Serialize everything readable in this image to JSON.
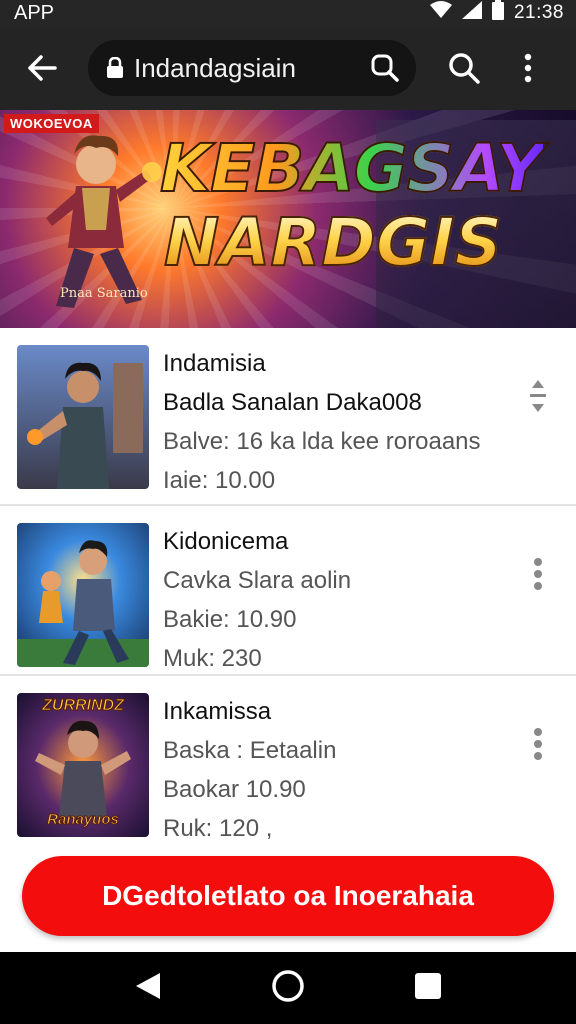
{
  "status_bar": {
    "app_label": "APP",
    "time": "21:38"
  },
  "browser": {
    "url": "Indandagsiain"
  },
  "banner": {
    "tag": "WOKOEVOA",
    "title_line1": "KEBAGSAY",
    "title_line2": "NARDGIS",
    "caption": "Pnaa Saranio"
  },
  "items": [
    {
      "title": "Indamisia",
      "line1": "Badla Sanalan Daka008",
      "line2": "Balve: 16 ka lda kee roroaans",
      "line3": "Iaie: 10.00"
    },
    {
      "title": "Kidonicema",
      "line1": "Cavka Slara aolin",
      "line2": "Bakie: 10.90",
      "line3": "Muk: 230"
    },
    {
      "title": "Inkamissa",
      "line1": "Baska : Eetaalin",
      "line2": "Baokar 10.90",
      "line3": "Ruk: 120 ,"
    }
  ],
  "thumb_badges": {
    "item3": "ZURRINDZ",
    "item3_sub": "Ranayuos"
  },
  "cta": {
    "label": "DGedtoletlato oa Inoerahaia"
  },
  "colors": {
    "accent": "#f40d0d",
    "app_bar": "#242424",
    "nav_bar": "#000000"
  }
}
